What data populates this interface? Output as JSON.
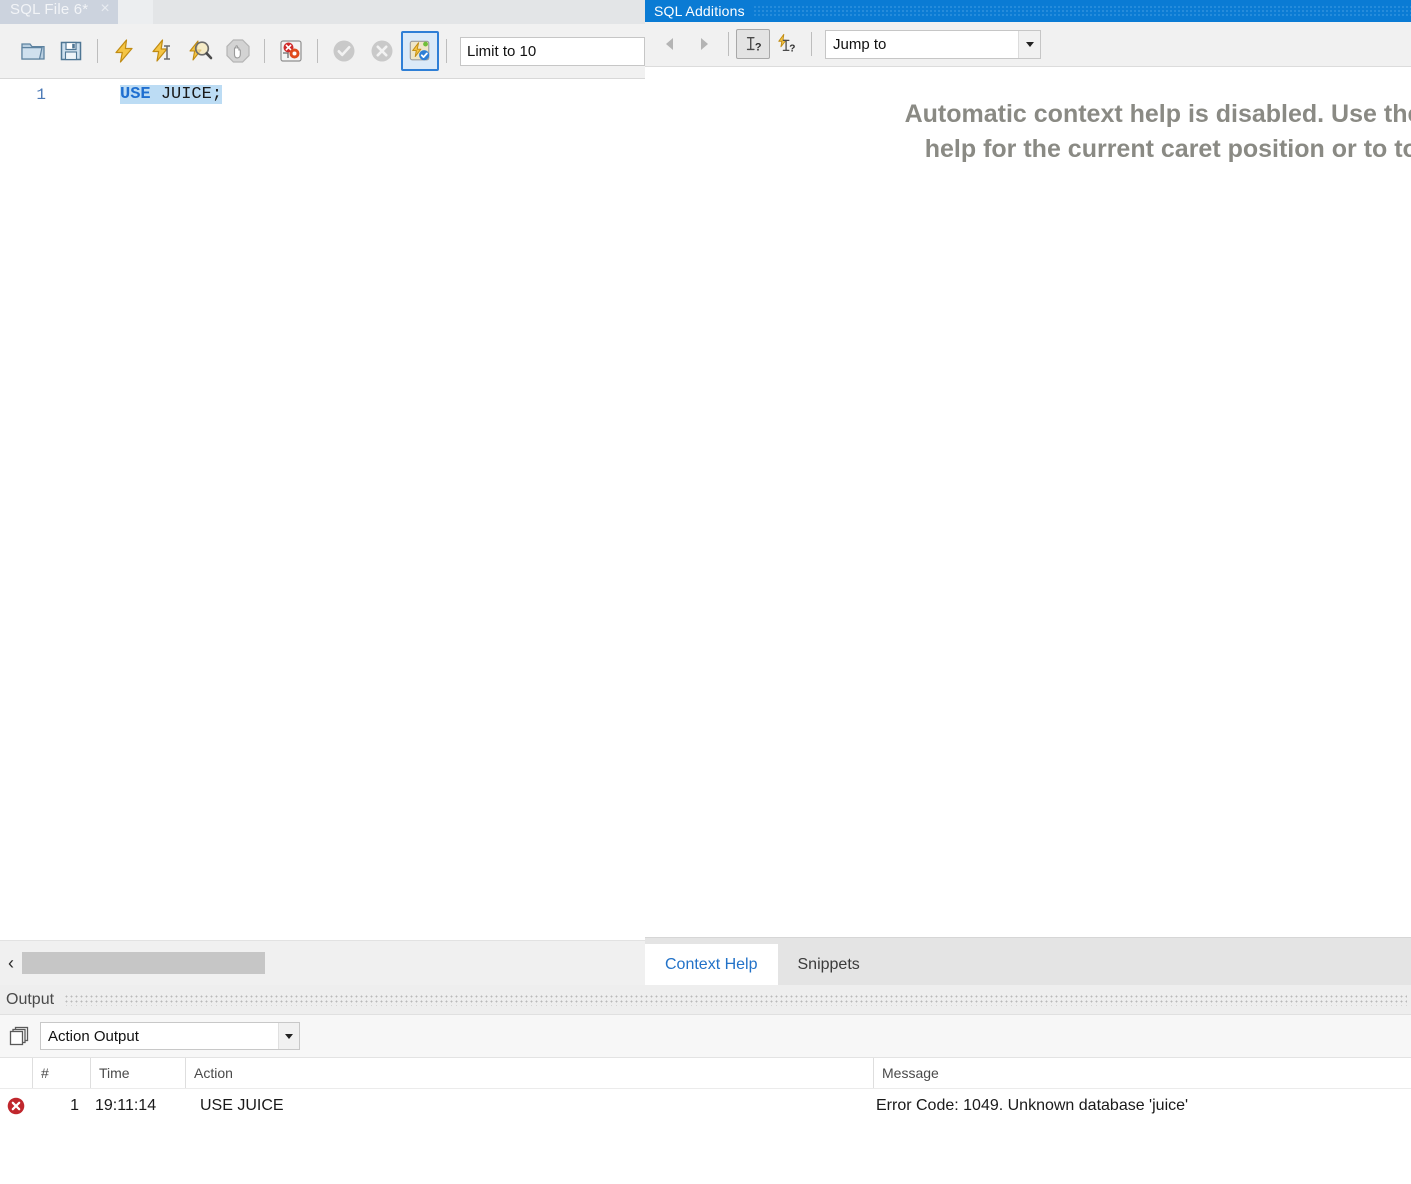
{
  "editor": {
    "tab": {
      "label": "SQL File 6*",
      "close_glyph": "×"
    },
    "toolbar": {
      "buttons": [
        {
          "name": "open-sql-script-icon",
          "title": "Open a SQL script file"
        },
        {
          "name": "save-script-icon",
          "title": "Save script"
        },
        {
          "name": "execute-statement-icon",
          "title": "Execute the selected portion of the script"
        },
        {
          "name": "execute-current-statement-icon",
          "title": "Execute the statement under the keyboard cursor"
        },
        {
          "name": "explain-query-icon",
          "title": "Explain the statement under the keyboard cursor"
        },
        {
          "name": "stop-execution-icon",
          "title": "Stop the query being executed"
        },
        {
          "name": "toggle-stop-on-error-icon",
          "title": "Toggle whether execution should stop on errors"
        },
        {
          "name": "commit-icon",
          "title": "Commit"
        },
        {
          "name": "rollback-icon",
          "title": "Rollback"
        },
        {
          "name": "toggle-autocommit-icon",
          "title": "Toggle autocommit mode"
        }
      ],
      "limit_label": "Limit to 10"
    },
    "code": {
      "line_number": "1",
      "tokens": {
        "keyword": "USE",
        "space": " ",
        "identifier": "JUICE",
        "punctuation": ";"
      }
    },
    "scrollbar": {
      "left_arrow_glyph": "‹"
    }
  },
  "additions": {
    "title": "SQL Additions",
    "toolbar": {
      "back_label": "◀",
      "forward_label": "▶",
      "context_help_button": "context-help-icon",
      "automatic_context_help_button": "automatic-context-help-icon",
      "jump_to": {
        "value": "Jump to",
        "placeholder": "Jump to"
      }
    },
    "context_help_message": "Automatic context help is disabled. Use the toolb\nhelp for the current caret position or to toggle",
    "tabs": [
      {
        "label": "Context Help",
        "selected": true
      },
      {
        "label": "Snippets",
        "selected": false
      }
    ]
  },
  "output": {
    "title": "Output",
    "selector": {
      "value": "Action Output"
    },
    "columns": {
      "status": "",
      "num": "#",
      "time": "Time",
      "action": "Action",
      "message": "Message"
    },
    "rows": [
      {
        "status": "error",
        "num": "1",
        "time": "19:11:14",
        "action": "USE JUICE",
        "message": "Error Code: 1049. Unknown database 'juice'"
      }
    ]
  },
  "colors": {
    "accent_blue": "#0a7bd4",
    "tab_selected_text": "#2272c8",
    "keyword_blue": "#1f6fd0",
    "selection_blue": "#bcdcf4",
    "error_red": "#c0272d",
    "help_text_gray": "#8a8a84"
  }
}
